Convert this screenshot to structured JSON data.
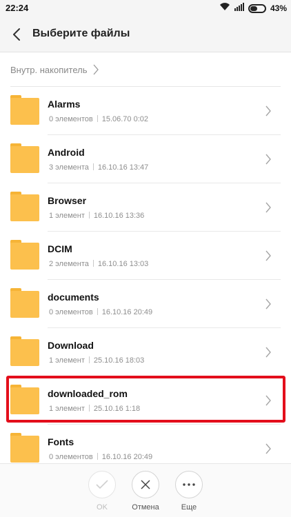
{
  "status_bar": {
    "time": "22:24",
    "battery": "43%"
  },
  "header": {
    "title": "Выберите файлы"
  },
  "breadcrumb": {
    "location": "Внутр. накопитель"
  },
  "folders": [
    {
      "name": "Alarms",
      "count": "0 элементов",
      "date": "15.06.70 0:02"
    },
    {
      "name": "Android",
      "count": "3 элемента",
      "date": "16.10.16 13:47"
    },
    {
      "name": "Browser",
      "count": "1 элемент",
      "date": "16.10.16 13:36"
    },
    {
      "name": "DCIM",
      "count": "2 элемента",
      "date": "16.10.16 13:03"
    },
    {
      "name": "documents",
      "count": "0 элементов",
      "date": "16.10.16 20:49"
    },
    {
      "name": "Download",
      "count": "1 элемент",
      "date": "25.10.16 18:03"
    },
    {
      "name": "downloaded_rom",
      "count": "1 элемент",
      "date": "25.10.16 1:18"
    },
    {
      "name": "Fonts",
      "count": "0 элементов",
      "date": "16.10.16 20:49"
    }
  ],
  "bottom_bar": {
    "ok_label": "OK",
    "cancel_label": "Отмена",
    "more_label": "Еще"
  },
  "colors": {
    "folder": "#fcc04d",
    "highlight": "#e30e1b"
  },
  "icons": [
    "wifi-icon",
    "signal-icon",
    "battery-icon",
    "back-arrow-icon",
    "chevron-right-icon",
    "folder-icon",
    "check-icon",
    "close-icon",
    "more-icon"
  ]
}
